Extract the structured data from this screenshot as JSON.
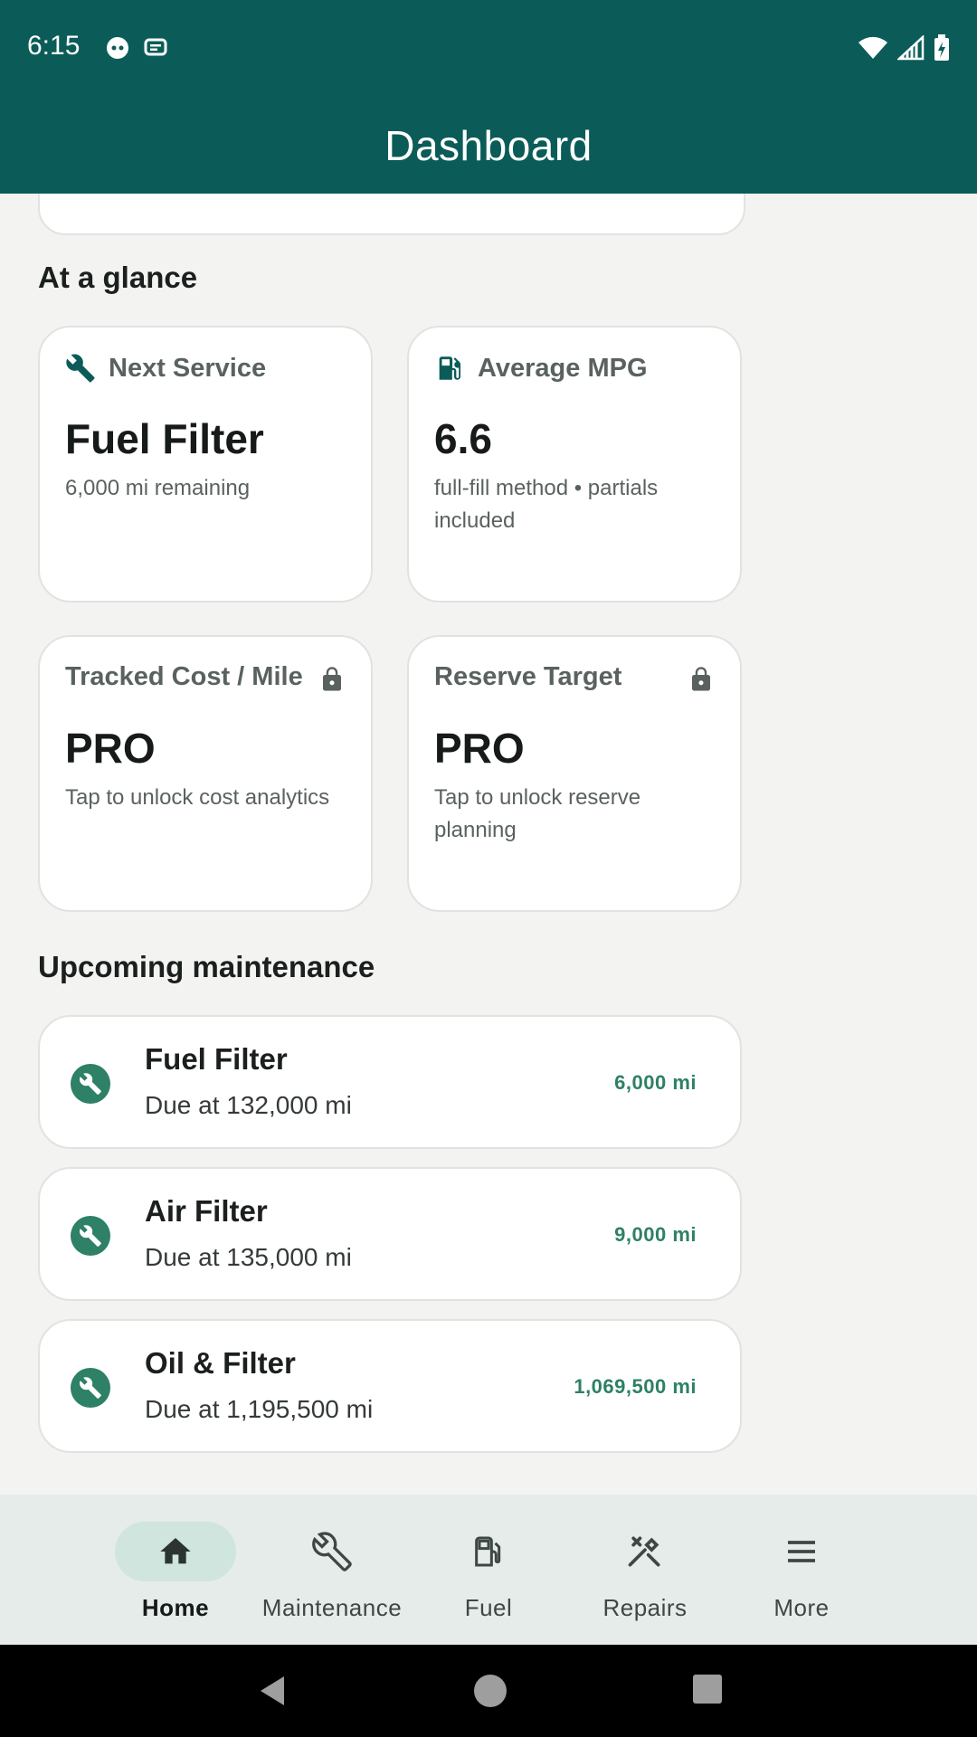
{
  "status_bar": {
    "time": "6:15"
  },
  "app_bar": {
    "title": "Dashboard"
  },
  "sections": {
    "at_a_glance": "At a glance",
    "upcoming": "Upcoming maintenance"
  },
  "stats": [
    {
      "label": "Next Service",
      "value": "Fuel Filter",
      "sub": "6,000 mi remaining",
      "icon": "wrench-icon",
      "locked": false
    },
    {
      "label": "Average MPG",
      "value": "6.6",
      "sub": "full-fill method • partials included",
      "icon": "fuel-pump-icon",
      "locked": false
    },
    {
      "label": "Tracked Cost / Mile",
      "value": "PRO",
      "sub": "Tap to unlock cost analytics",
      "icon": "lock-icon",
      "locked": true
    },
    {
      "label": "Reserve Target",
      "value": "PRO",
      "sub": "Tap to unlock reserve planning",
      "icon": "lock-icon",
      "locked": true
    }
  ],
  "maintenance": [
    {
      "name": "Fuel Filter",
      "due": "Due at 132,000 mi",
      "remaining": "6,000 mi"
    },
    {
      "name": "Air Filter",
      "due": "Due at 135,000 mi",
      "remaining": "9,000 mi"
    },
    {
      "name": "Oil & Filter",
      "due": "Due at 1,195,500 mi",
      "remaining": "1,069,500 mi"
    }
  ],
  "nav": [
    {
      "label": "Home",
      "icon": "home-icon",
      "active": true
    },
    {
      "label": "Maintenance",
      "icon": "wrench-icon",
      "active": false
    },
    {
      "label": "Fuel",
      "icon": "fuel-pump-icon",
      "active": false
    },
    {
      "label": "Repairs",
      "icon": "repair-tools-icon",
      "active": false
    },
    {
      "label": "More",
      "icon": "menu-icon",
      "active": false
    }
  ],
  "colors": {
    "primary": "#0b5c58",
    "accent_green": "#2e8066",
    "nav_pill": "#cfe5de",
    "background": "#f3f4f2"
  }
}
